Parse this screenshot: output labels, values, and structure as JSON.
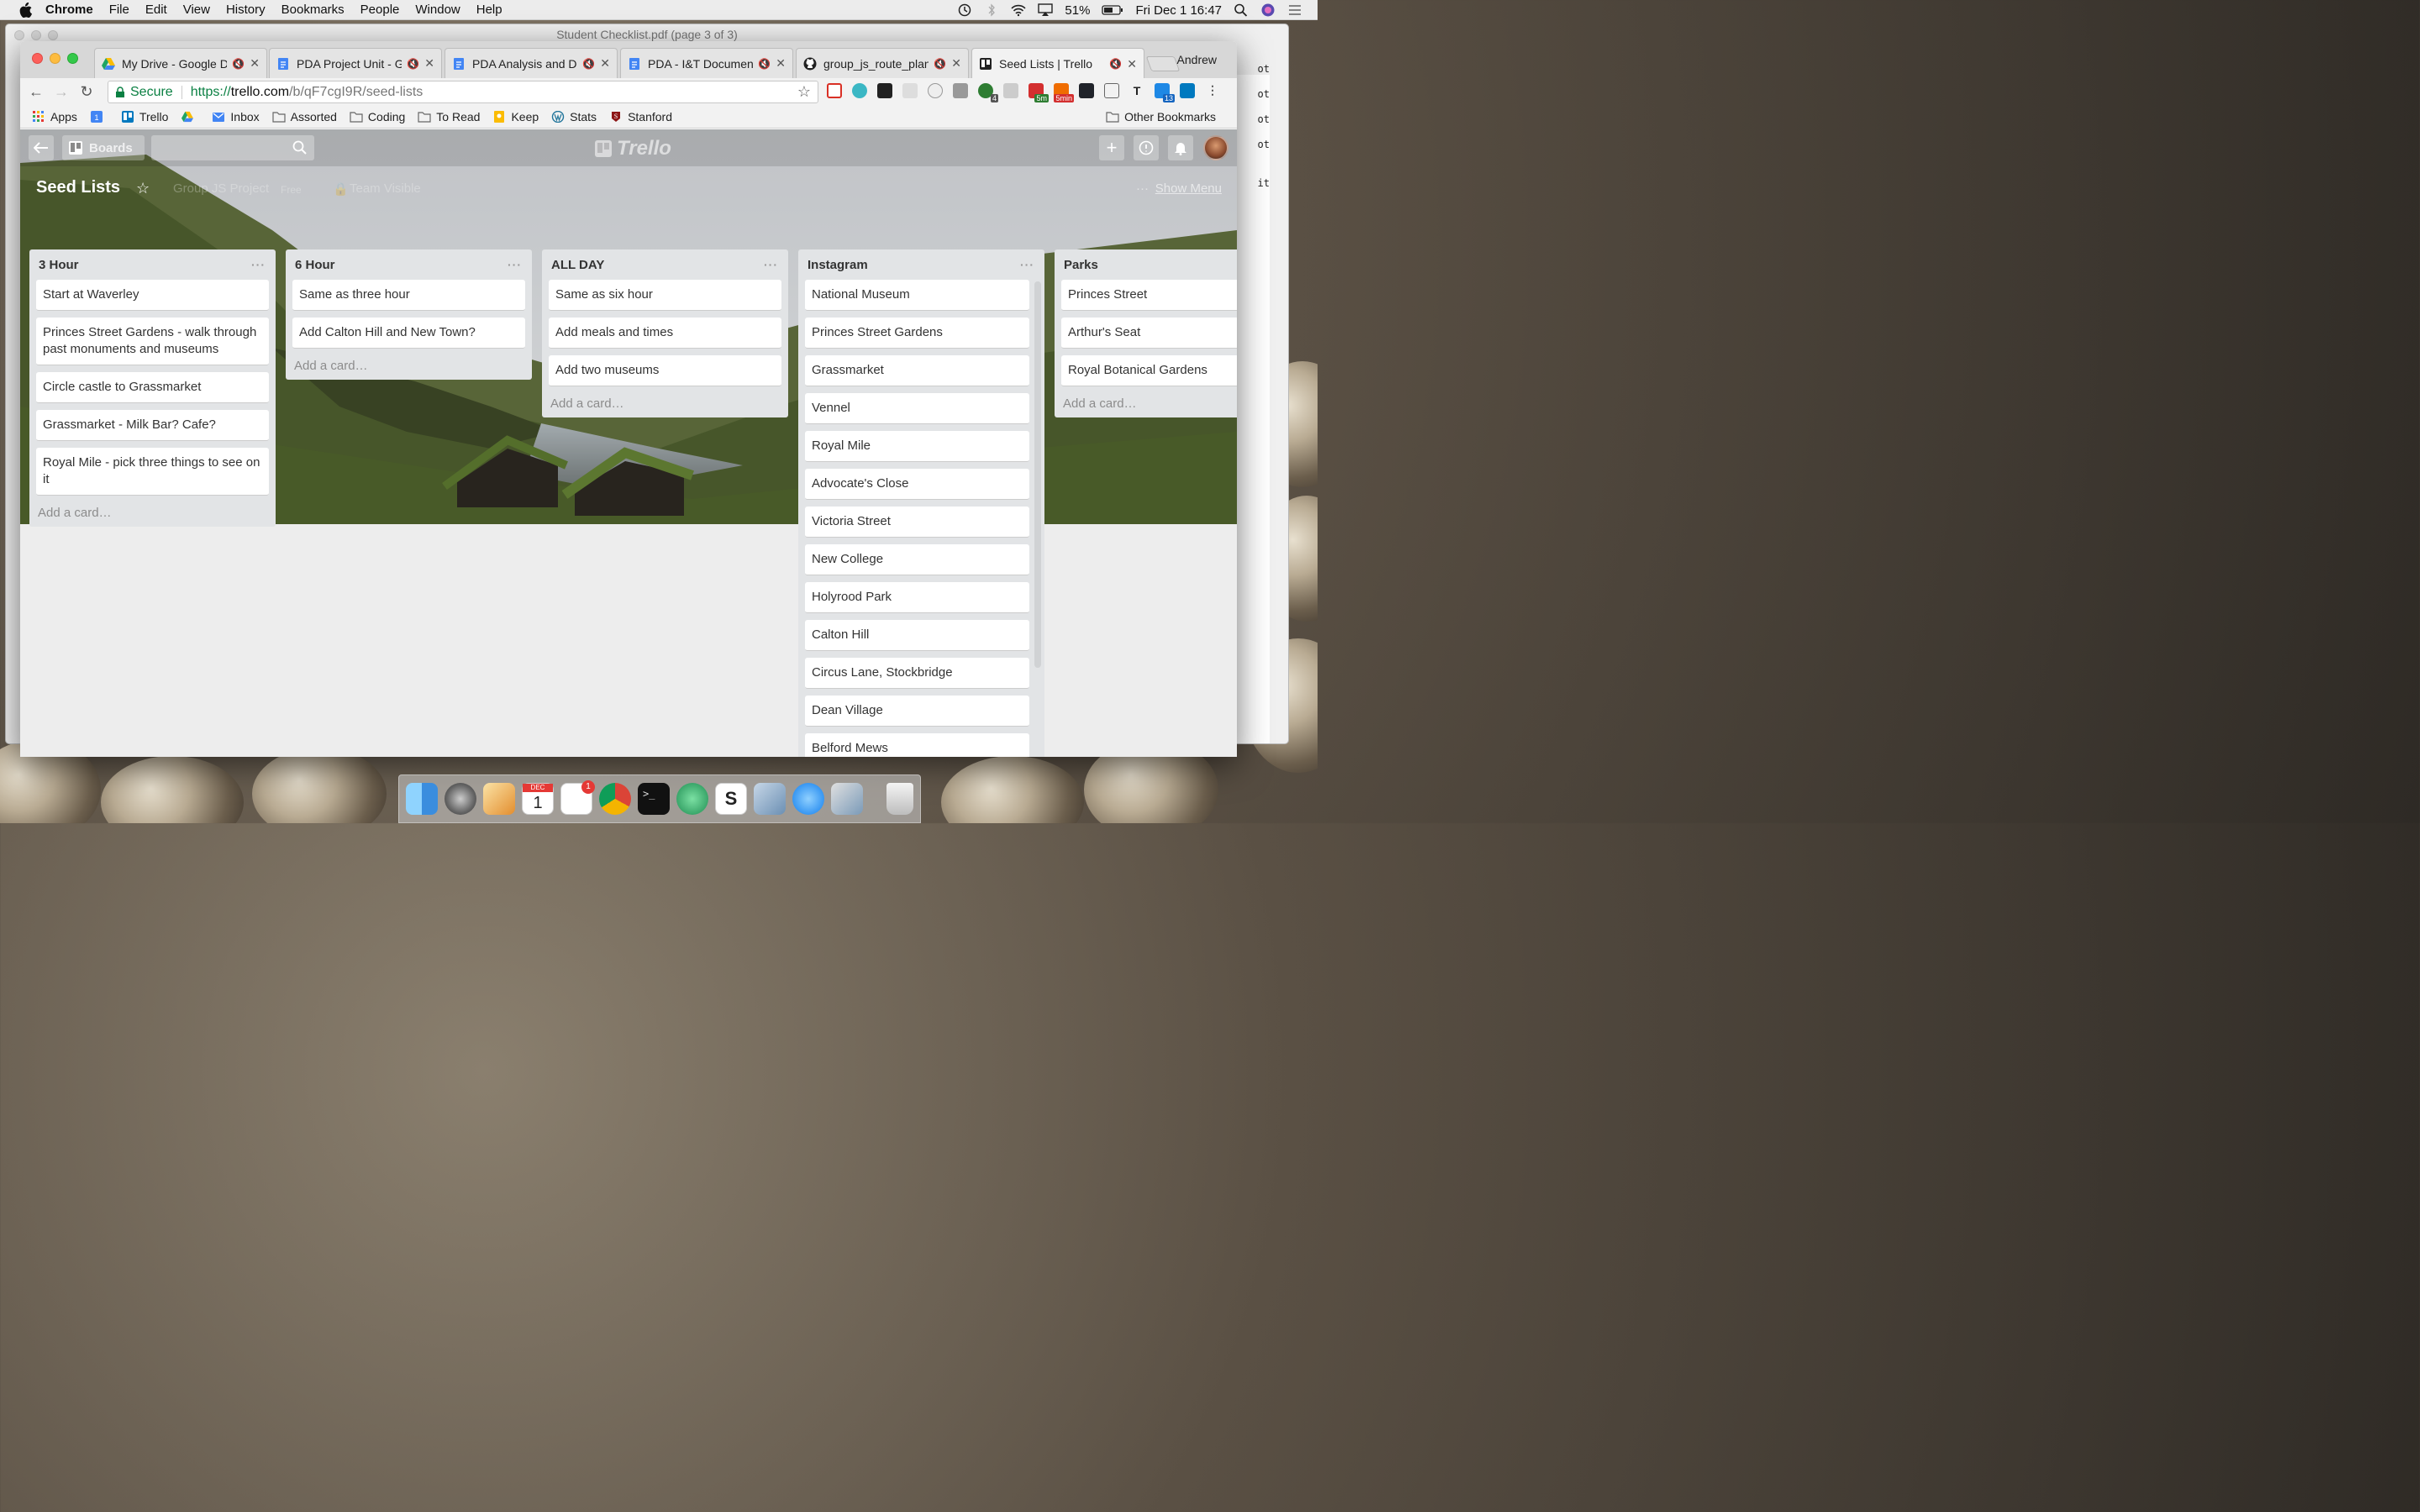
{
  "menubar": {
    "app": "Chrome",
    "items": [
      "File",
      "Edit",
      "View",
      "History",
      "Bookmarks",
      "People",
      "Window",
      "Help"
    ],
    "battery": "51%",
    "datetime": "Fri Dec 1  16:47"
  },
  "pdf_window": {
    "title": "Student Checklist.pdf (page 3 of 3)",
    "text_snippets": [
      "ot",
      "ot",
      "ot",
      "ot",
      "it"
    ]
  },
  "browser": {
    "tabs": [
      {
        "title": "My Drive - Google Dr",
        "active": false
      },
      {
        "title": "PDA Project Unit - Go",
        "active": false
      },
      {
        "title": "PDA Analysis and De",
        "active": false
      },
      {
        "title": "PDA - I&T Document",
        "active": false
      },
      {
        "title": "group_js_route_plann",
        "active": false
      },
      {
        "title": "Seed Lists | Trello",
        "active": true
      }
    ],
    "profile": "Andrew",
    "url": {
      "secure_label": "Secure",
      "scheme": "https://",
      "host": "trello.com",
      "path": "/b/qF7cgI9R/seed-lists"
    },
    "extension_badges": [
      "4",
      "5m",
      "5min",
      "13"
    ],
    "bookmarks": [
      "Apps",
      "Trello",
      "Inbox",
      "Assorted",
      "Coding",
      "To Read",
      "Keep",
      "Stats",
      "Stanford"
    ],
    "other_bookmarks": "Other Bookmarks"
  },
  "board": {
    "header": {
      "boards_label": "Boards",
      "logo": "Trello"
    },
    "title": "Seed Lists",
    "team": "Group JS Project",
    "plan": "Free",
    "visibility": "Team Visible",
    "show_menu": "Show Menu",
    "add_card": "Add a card…",
    "lists": [
      {
        "name": "3 Hour",
        "cards": [
          "Start at Waverley",
          "Princes Street Gardens - walk through past monuments and museums",
          "Circle castle to Grassmarket",
          "Grassmarket - Milk Bar? Cafe?",
          "Royal Mile - pick three things to see on it"
        ]
      },
      {
        "name": "6 Hour",
        "cards": [
          "Same as three hour",
          "Add Calton Hill and New Town?"
        ]
      },
      {
        "name": "ALL DAY",
        "cards": [
          "Same as six hour",
          "Add meals and times",
          "Add two museums"
        ]
      },
      {
        "name": "Instagram",
        "cards": [
          "National Museum",
          "Princes Street Gardens",
          "Grassmarket",
          "Vennel",
          "Royal Mile",
          "Advocate's Close",
          "Victoria Street",
          "New College",
          "Holyrood Park",
          "Calton Hill",
          "Circus Lane, Stockbridge",
          "Dean Village",
          "Belford Mews"
        ]
      },
      {
        "name": "Parks",
        "cards": [
          "Princes Street",
          "Arthur's Seat",
          "Royal Botanical Gardens"
        ]
      }
    ]
  },
  "dock": {
    "items": [
      "finder",
      "system-preferences",
      "pages",
      "calendar",
      "reminders",
      "chrome",
      "terminal",
      "atom",
      "slack",
      "preview",
      "messages",
      "image-capture",
      "trash"
    ],
    "calendar_day": "1",
    "calendar_month": "DEC",
    "reminders_badge": "1"
  }
}
